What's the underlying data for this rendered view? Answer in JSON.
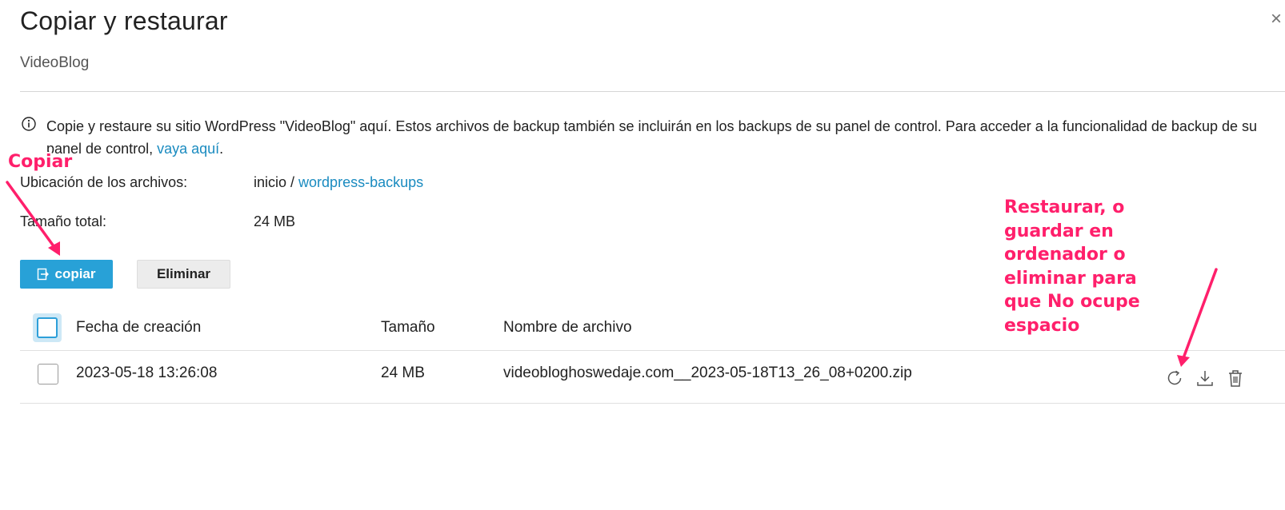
{
  "dialog": {
    "title": "Copiar y restaurar",
    "subtitle": "VideoBlog",
    "close_glyph": "×"
  },
  "info": {
    "text": "Copie y restaure su sitio WordPress \"VideoBlog\" aquí. Estos archivos de backup también se incluirán en los backups de su panel de control. Para acceder a la funcionalidad de backup de su panel de control, ",
    "link_text": "vaya aquí",
    "trailing": "."
  },
  "file_location": {
    "label": "Ubicación de los archivos:",
    "root": "inicio",
    "separator": " / ",
    "folder_link": "wordpress-backups"
  },
  "total_size": {
    "label": "Tamaño total:",
    "value": "24 MB"
  },
  "toolbar": {
    "copy_label": "copiar",
    "delete_label": "Eliminar"
  },
  "table": {
    "columns": [
      "Fecha de creación",
      "Tamaño",
      "Nombre de archivo"
    ],
    "rows": [
      {
        "date": "2023-05-18 13:26:08",
        "size": "24 MB",
        "filename": "videobloghoswedaje.com__2023-05-18T13_26_08+0200.zip",
        "actions": [
          "restore-icon",
          "download-icon",
          "trash-icon"
        ]
      }
    ]
  },
  "annotations": {
    "copy": "Copiar",
    "restore_lines": [
      "Restaurar, o",
      "guardar en",
      "ordenador o",
      "eliminar para",
      "que No ocupe",
      "espacio"
    ]
  },
  "colors": {
    "primary": "#28a1d7",
    "link": "#1a8bc0",
    "annotation": "#ff1f6b"
  }
}
